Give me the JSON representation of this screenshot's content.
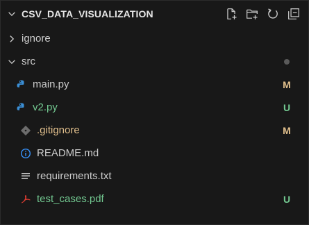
{
  "explorer": {
    "title": "CSV_DATA_VISUALIZATION",
    "actions": [
      {
        "name": "new-file-icon"
      },
      {
        "name": "new-folder-icon"
      },
      {
        "name": "refresh-icon"
      },
      {
        "name": "collapse-all-icon"
      }
    ],
    "items": [
      {
        "label": "ignore",
        "type": "folder",
        "expanded": false
      },
      {
        "label": "src",
        "type": "folder",
        "expanded": true,
        "status": "dot"
      },
      {
        "label": "main.py",
        "type": "python",
        "badge": "M"
      },
      {
        "label": "v2.py",
        "type": "python",
        "badge": "U"
      },
      {
        "label": ".gitignore",
        "type": "git",
        "badge": "M"
      },
      {
        "label": "README.md",
        "type": "info"
      },
      {
        "label": "requirements.txt",
        "type": "text"
      },
      {
        "label": "test_cases.pdf",
        "type": "pdf",
        "badge": "U"
      }
    ]
  },
  "colors": {
    "modified": "#e2c08d",
    "untracked": "#73c991",
    "python_blue": "#3b8fd6",
    "python_yellow": "#f6d245",
    "pdf_red": "#e03c31",
    "info_blue": "#3794ff"
  }
}
